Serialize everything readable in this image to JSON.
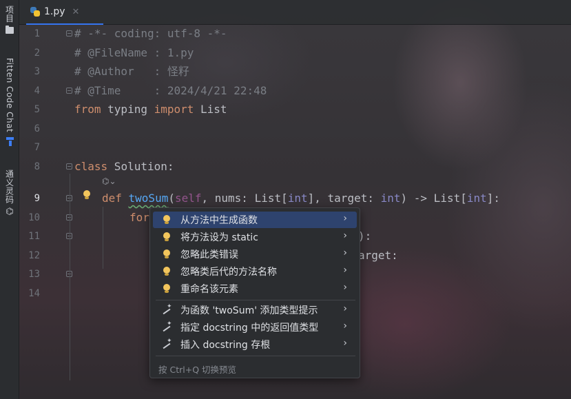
{
  "toolstrip": {
    "project_label": "项目",
    "fitten_label": "Fitten Code Chat",
    "tongyi_label": "通义灵码"
  },
  "tab": {
    "filename": "1.py",
    "close": "✕"
  },
  "lines": [
    "1",
    "2",
    "3",
    "4",
    "5",
    "6",
    "7",
    "8",
    "9",
    "10",
    "11",
    "12",
    "13",
    "14"
  ],
  "code": {
    "l1": "# -*- coding: utf-8 -*-",
    "l2": "# @FileName : 1.py",
    "l3": "# @Author   : 怪籽",
    "l4": "# @Time     : 2024/4/21 22:48",
    "l5_from": "from",
    "l5_mod": " typing ",
    "l5_import": "import",
    "l5_name": " List",
    "l8_class": "class",
    "l8_name": " Solution:",
    "l9_def": "def ",
    "l9_fn": "twoSum",
    "l9_p1": "(",
    "l9_self": "self",
    "l9_p2": ", nums: List[",
    "l9_int1": "int",
    "l9_p3": "], target: ",
    "l9_int2": "int",
    "l9_p4": ") -> List[",
    "l9_int3": "int",
    "l9_p5": "]:",
    "l10_for": "for",
    "l11_tail": "):",
    "l12_tail": "arget:",
    "ai_hint": "⌬⌄"
  },
  "popup": {
    "items": [
      {
        "label": "从方法中生成函数",
        "icon": "bulb-icon",
        "arrow": "›"
      },
      {
        "label": "将方法设为 static",
        "icon": "bulb-icon",
        "arrow": "›"
      },
      {
        "label": "忽略此类错误",
        "icon": "bulb-icon",
        "arrow": "›"
      },
      {
        "label": "忽略类后代的方法名称",
        "icon": "bulb-icon",
        "arrow": "›"
      },
      {
        "label": "重命名该元素",
        "icon": "bulb-icon",
        "arrow": "›"
      },
      {
        "label": "为函数 'twoSum' 添加类型提示",
        "icon": "wand-icon",
        "arrow": "›"
      },
      {
        "label": "指定 docstring 中的返回值类型",
        "icon": "wand-icon",
        "arrow": "›"
      },
      {
        "label": "插入 docstring 存根",
        "icon": "wand-icon",
        "arrow": "›"
      }
    ],
    "footer": "按 Ctrl+Q 切换预览"
  },
  "colors": {
    "selection": "#2e436e",
    "keyword": "#cf8e6d",
    "function": "#56a8f5",
    "comment": "#7a7e85"
  }
}
